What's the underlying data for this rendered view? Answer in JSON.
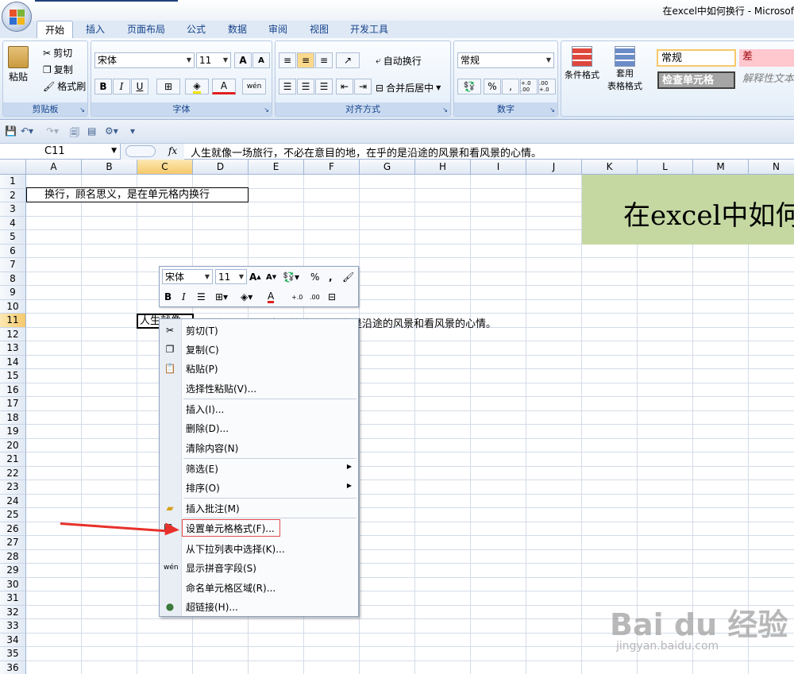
{
  "window": {
    "title": "在excel中如何换行 - Microsof"
  },
  "ribbon": {
    "tabs": [
      "开始",
      "插入",
      "页面布局",
      "公式",
      "数据",
      "审阅",
      "视图",
      "开发工具"
    ],
    "clipboard": {
      "label": "剪贴板",
      "paste": "粘贴",
      "cut": "剪切",
      "copy": "复制",
      "format_painter": "格式刷"
    },
    "font": {
      "label": "字体",
      "name": "宋体",
      "size": "11",
      "grow": "A",
      "shrink": "A",
      "bold": "B",
      "italic": "I",
      "underline": "U",
      "font_color": "A",
      "phonetic": "wén"
    },
    "alignment": {
      "label": "对齐方式",
      "wrap": "自动换行",
      "merge": "合并后居中"
    },
    "number": {
      "label": "数字",
      "format": "常规",
      "percent": "%",
      "comma": ",",
      "inc": "+.0 .00",
      "dec": ".00 +.0"
    },
    "styles": {
      "conditional": "条件格式",
      "table": "套用",
      "table2": "表格格式",
      "normal": "常规",
      "bad": "差",
      "check": "检查单元格",
      "explain": "解释性文本"
    }
  },
  "formula_bar": {
    "name_box": "C11",
    "fx": "fx",
    "content": "人生就像一场旅行，不必在意目的地，在乎的是沿途的风景和看风景的心情。"
  },
  "grid": {
    "columns": [
      "A",
      "B",
      "C",
      "D",
      "E",
      "F",
      "G",
      "H",
      "I",
      "J",
      "K",
      "L",
      "M",
      "N"
    ],
    "rows": [
      "1",
      "2",
      "3",
      "4",
      "5",
      "6",
      "7",
      "8",
      "9",
      "10",
      "11",
      "12",
      "13",
      "14",
      "15",
      "16",
      "17",
      "18",
      "19",
      "20",
      "21",
      "22",
      "23",
      "24",
      "25",
      "26",
      "27",
      "28",
      "29",
      "30",
      "31",
      "32",
      "33",
      "34",
      "35",
      "36"
    ],
    "cell_b2": "换行，顾名思义，是在单元格内换行",
    "banner": "在excel中如何",
    "cell_c11": "人生就像",
    "c11_overflow": "场旅行，不必在意目的地，在乎的是沿途的风景和看风景的心情。"
  },
  "mini_toolbar": {
    "font": "宋体",
    "size": "11",
    "bold": "B",
    "italic": "I",
    "percent": "%",
    "comma": ",",
    "font_color": "A"
  },
  "context_menu": {
    "items": [
      {
        "label": "剪切(T)",
        "icon": "scissors-icon"
      },
      {
        "label": "复制(C)",
        "icon": "copy-icon"
      },
      {
        "label": "粘贴(P)",
        "icon": "paste-icon"
      },
      {
        "label": "选择性粘贴(V)...",
        "icon": ""
      },
      {
        "label": "插入(I)...",
        "icon": ""
      },
      {
        "label": "删除(D)...",
        "icon": ""
      },
      {
        "label": "清除内容(N)",
        "icon": ""
      },
      {
        "label": "筛选(E)",
        "icon": ""
      },
      {
        "label": "排序(O)",
        "icon": ""
      },
      {
        "label": "插入批注(M)",
        "icon": "comment-icon"
      },
      {
        "label": "设置单元格格式(F)...",
        "icon": "format-cells-icon"
      },
      {
        "label": "从下拉列表中选择(K)...",
        "icon": ""
      },
      {
        "label": "显示拼音字段(S)",
        "icon": "phonetic-icon"
      },
      {
        "label": "命名单元格区域(R)...",
        "icon": ""
      },
      {
        "label": "超链接(H)...",
        "icon": "hyperlink-icon"
      }
    ]
  },
  "watermark": {
    "main": "Bai du 经验",
    "sub": "jingyan.baidu.com"
  },
  "colors": {
    "accent": "#15428b",
    "banner": "#c5d8a2",
    "highlight": "#e34b4b",
    "arrow": "#e8302b"
  }
}
